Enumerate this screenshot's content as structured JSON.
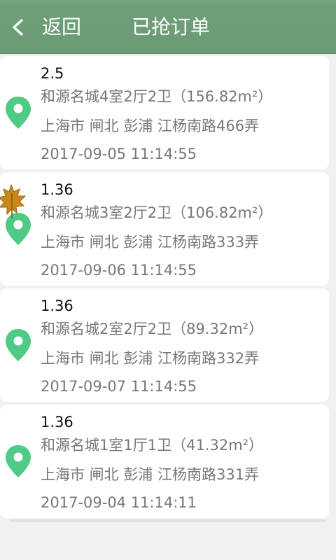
{
  "header": {
    "back_label": "返回",
    "title": "已抢订单",
    "colors": {
      "bar": "#6a9b73",
      "text": "#ffffff"
    }
  },
  "orders": [
    {
      "price": "2.5",
      "title": "和源名城4室2厅2卫（156.82m²）",
      "address": "上海市 闸北 彭浦 江杨南路466弄",
      "time": "2017-09-05 11:14:55"
    },
    {
      "price": "1.36",
      "title": "和源名城3室2厅2卫（106.82m²）",
      "address": "上海市 闸北 彭浦 江杨南路333弄",
      "time": "2017-09-06 11:14:55"
    },
    {
      "price": "1.36",
      "title": "和源名城2室2厅2卫（89.32m²）",
      "address": "上海市 闸北 彭浦 江杨南路332弄",
      "time": "2017-09-07 11:14:55"
    },
    {
      "price": "1.36",
      "title": "和源名城1室1厅1卫（41.32m²）",
      "address": "上海市 闸北 彭浦 江杨南路331弄",
      "time": "2017-09-04 11:14:11"
    }
  ],
  "icons": {
    "location": "map-pin-icon",
    "decoration": "maple-leaf-icon"
  },
  "accent_color": "#4fcb85"
}
